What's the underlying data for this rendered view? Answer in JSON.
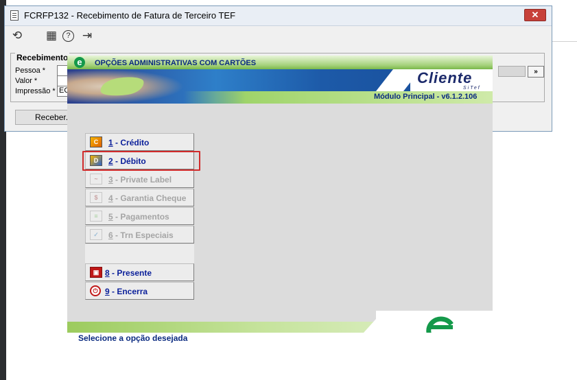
{
  "window": {
    "title": "FCRFP132 - Recebimento de Fatura de Terceiro TEF",
    "close_glyph": "✕",
    "toolbar": [
      {
        "name": "undo-icon",
        "glyph": "⟲"
      },
      {
        "name": "calendar-icon",
        "glyph": "▦"
      },
      {
        "name": "help-icon",
        "glyph": "?"
      },
      {
        "name": "exit-icon",
        "glyph": "⇥"
      }
    ],
    "group_label": "Recebimento",
    "fields": [
      {
        "label": "Pessoa *",
        "value": ""
      },
      {
        "label": "Valor *",
        "value": ""
      },
      {
        "label": "Impressão *",
        "value": "EC"
      }
    ],
    "side_button": "»",
    "receber_label": "Receber..."
  },
  "dialog": {
    "header_title": "OPÇÕES ADMINISTRATIVAS COM CARTÕES",
    "header_logo_glyph": "e",
    "brand": "Cliente",
    "brand_sub": "SiTef",
    "module": "Módulo Principal - v6.1.2.106",
    "menu": [
      {
        "key": "1",
        "label": " - Crédito",
        "icon": "credit-card-icon",
        "enabled": true
      },
      {
        "key": "2",
        "label": " - Débito",
        "icon": "debit-card-icon",
        "enabled": true
      },
      {
        "key": "3",
        "label": " - Private Label",
        "icon": "private-label-card-icon",
        "enabled": false
      },
      {
        "key": "4",
        "label": " - Garantia Cheque",
        "icon": "check-guarantee-icon",
        "enabled": false
      },
      {
        "key": "5",
        "label": " - Pagamentos",
        "icon": "payments-icon",
        "enabled": false
      },
      {
        "key": "6",
        "label": " - Trn Especiais",
        "icon": "special-transactions-icon",
        "enabled": false
      },
      {
        "key": "8",
        "label": " - Presente",
        "icon": "gift-icon",
        "enabled": true
      },
      {
        "key": "9",
        "label": " - Encerra",
        "icon": "exit-shutdown-icon",
        "enabled": true
      }
    ],
    "status": "Selecione a opção desejada",
    "colors": {
      "label_blue": "#0a1f9a",
      "disabled_gray": "#a5a5a5",
      "highlight_red": "#d12b2b",
      "sitef_green": "#14994a"
    }
  }
}
